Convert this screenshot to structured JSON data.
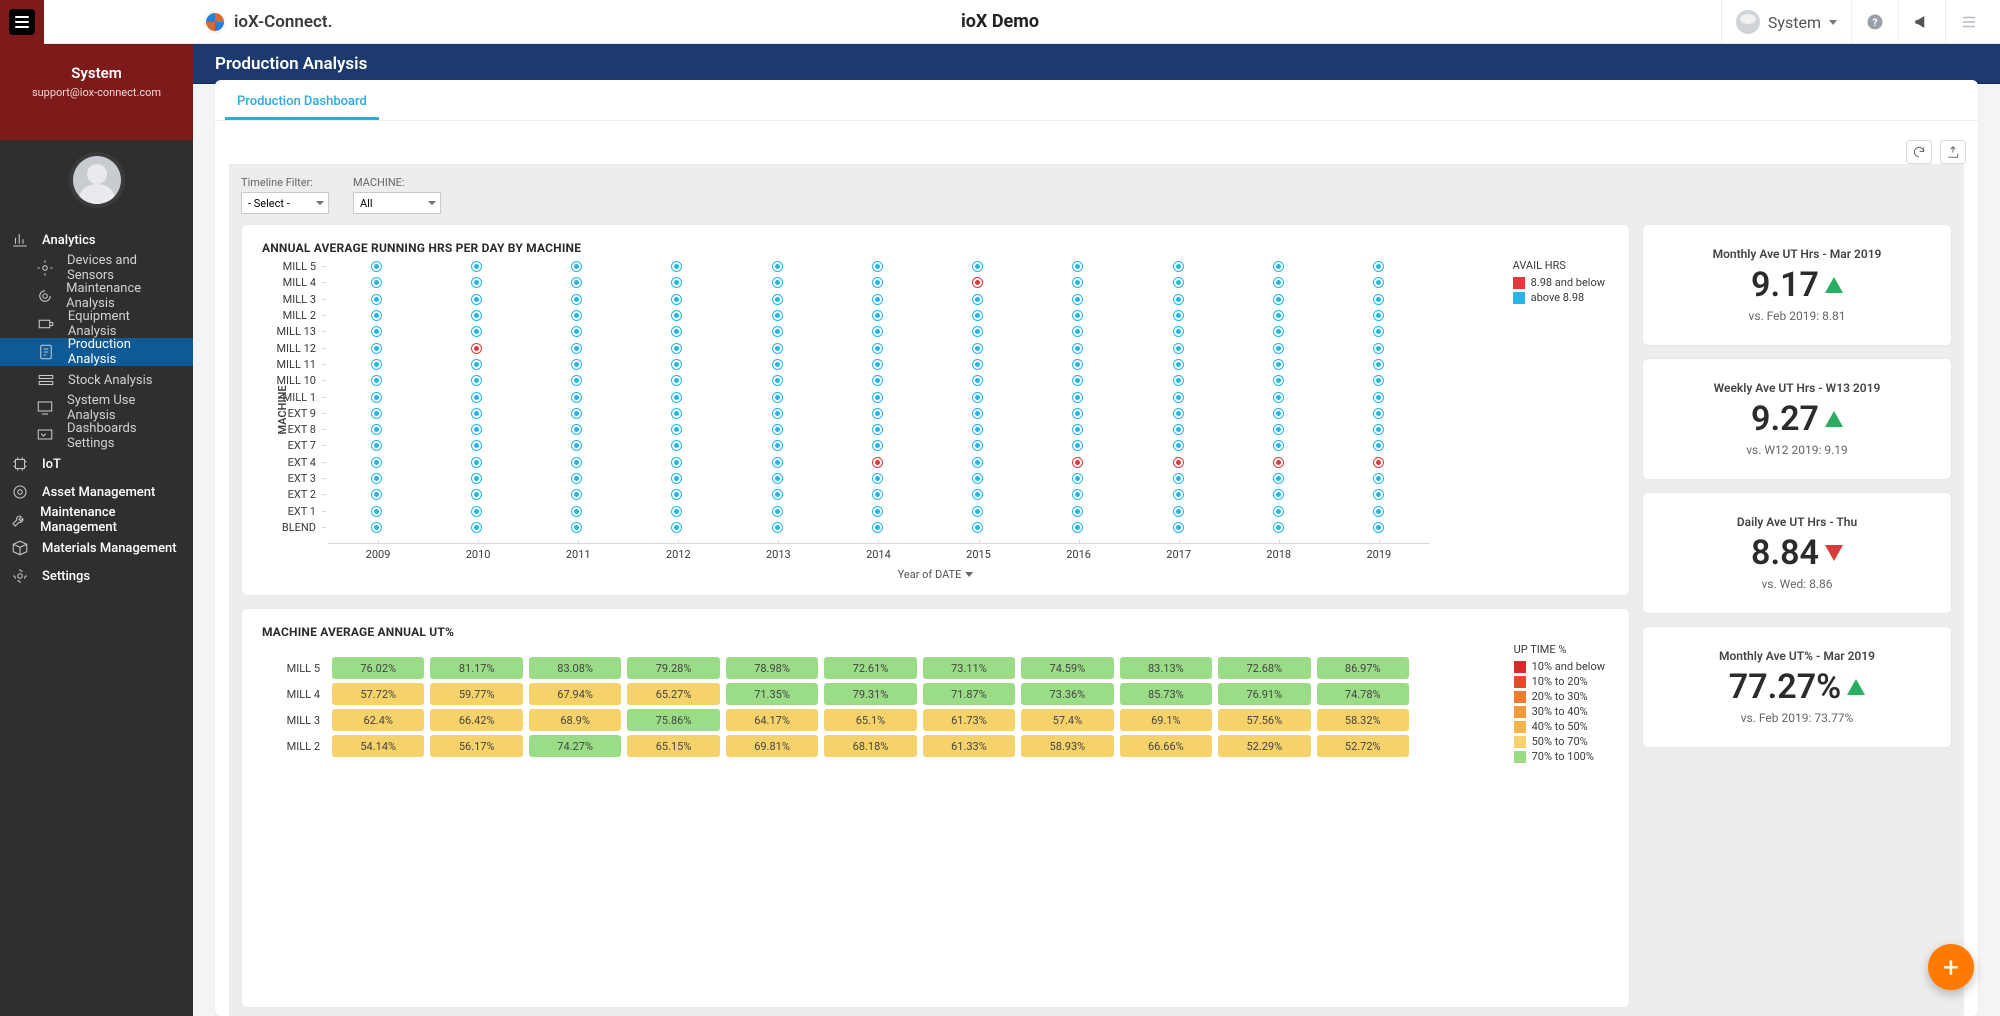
{
  "header": {
    "brand": "ioX-Connect.",
    "app_title": "ioX Demo",
    "user_label": "System"
  },
  "sidebar": {
    "user_name": "System",
    "user_email": "support@iox-connect.com",
    "top_items": [
      {
        "label": "Analytics",
        "top": true
      },
      {
        "label": "Devices and Sensors"
      },
      {
        "label": "Maintenance Analysis"
      },
      {
        "label": "Equipment Analysis"
      },
      {
        "label": "Production Analysis",
        "active": true
      },
      {
        "label": "Stock Analysis"
      },
      {
        "label": "System Use Analysis"
      },
      {
        "label": "Dashboards Settings"
      },
      {
        "label": "IoT",
        "top": true
      },
      {
        "label": "Asset Management",
        "top": true
      },
      {
        "label": "Maintenance Management",
        "top": true
      },
      {
        "label": "Materials Management",
        "top": true
      },
      {
        "label": "Settings",
        "top": true
      }
    ]
  },
  "page": {
    "title": "Production Analysis",
    "tab": "Production Dashboard",
    "filters": {
      "timeline_label": "Timeline Filter:",
      "timeline_value": "- Select -",
      "machine_label": "MACHINE:",
      "machine_value": "All"
    }
  },
  "chart_data": [
    {
      "type": "scatter",
      "title": "ANNUAL AVERAGE RUNNING HRS PER DAY BY MACHINE",
      "ylabel": "MACHINE",
      "xlabel": "Year of DATE",
      "x": [
        "2009",
        "2010",
        "2011",
        "2012",
        "2013",
        "2014",
        "2015",
        "2016",
        "2017",
        "2018",
        "2019"
      ],
      "legend_title": "AVAIL HRS",
      "legend": [
        {
          "label": "8.98 and below",
          "color": "#e03a3a"
        },
        {
          "label": "above 8.98",
          "color": "#25b6e8"
        }
      ],
      "rows": [
        {
          "label": "MILL 5",
          "v": [
            "c",
            "c",
            "c",
            "c",
            "c",
            "c",
            "c",
            "c",
            "c",
            "c",
            "c"
          ]
        },
        {
          "label": "MILL 4",
          "v": [
            "c",
            "c",
            "c",
            "c",
            "c",
            "c",
            "r",
            "c",
            "c",
            "c",
            "c"
          ]
        },
        {
          "label": "MILL 3",
          "v": [
            "c",
            "c",
            "c",
            "c",
            "c",
            "c",
            "c",
            "c",
            "c",
            "c",
            "c"
          ]
        },
        {
          "label": "MILL 2",
          "v": [
            "c",
            "c",
            "c",
            "c",
            "c",
            "c",
            "c",
            "c",
            "c",
            "c",
            "c"
          ]
        },
        {
          "label": "MILL 13",
          "v": [
            "c",
            "c",
            "c",
            "c",
            "c",
            "c",
            "c",
            "c",
            "c",
            "c",
            "c"
          ]
        },
        {
          "label": "MILL 12",
          "v": [
            "c",
            "r",
            "c",
            "c",
            "c",
            "c",
            "c",
            "c",
            "c",
            "c",
            "c"
          ]
        },
        {
          "label": "MILL 11",
          "v": [
            "c",
            "c",
            "c",
            "c",
            "c",
            "c",
            "c",
            "c",
            "c",
            "c",
            "c"
          ]
        },
        {
          "label": "MILL 10",
          "v": [
            "c",
            "c",
            "c",
            "c",
            "c",
            "c",
            "c",
            "c",
            "c",
            "c",
            "c"
          ]
        },
        {
          "label": "MILL 1",
          "v": [
            "c",
            "c",
            "c",
            "c",
            "c",
            "c",
            "c",
            "c",
            "c",
            "c",
            "c"
          ]
        },
        {
          "label": "EXT 9",
          "v": [
            "c",
            "c",
            "c",
            "c",
            "c",
            "c",
            "c",
            "c",
            "c",
            "c",
            "c"
          ]
        },
        {
          "label": "EXT 8",
          "v": [
            "c",
            "c",
            "c",
            "c",
            "c",
            "c",
            "c",
            "c",
            "c",
            "c",
            "c"
          ]
        },
        {
          "label": "EXT 7",
          "v": [
            "c",
            "c",
            "c",
            "c",
            "c",
            "c",
            "c",
            "c",
            "c",
            "c",
            "c"
          ]
        },
        {
          "label": "EXT 4",
          "v": [
            "c",
            "c",
            "c",
            "c",
            "c",
            "r",
            "c",
            "r",
            "r",
            "r",
            "r",
            "r"
          ]
        },
        {
          "label": "EXT 3",
          "v": [
            "c",
            "c",
            "c",
            "c",
            "c",
            "c",
            "c",
            "c",
            "c",
            "c",
            "c"
          ]
        },
        {
          "label": "EXT 2",
          "v": [
            "c",
            "c",
            "c",
            "c",
            "c",
            "c",
            "c",
            "c",
            "c",
            "c",
            "c"
          ]
        },
        {
          "label": "EXT 1",
          "v": [
            "c",
            "c",
            "c",
            "c",
            "c",
            "c",
            "c",
            "c",
            "c",
            "c",
            "c"
          ]
        },
        {
          "label": "BLEND",
          "v": [
            "c",
            "c",
            "c",
            "c",
            "c",
            "c",
            "c",
            "c",
            "c",
            "c",
            "c"
          ]
        }
      ]
    },
    {
      "type": "heatmap",
      "title": "MACHINE AVERAGE ANNUAL UT%",
      "legend_title": "UP TIME %",
      "legend": [
        {
          "label": "10% and below",
          "color": "#d62a2a"
        },
        {
          "label": "10% to 20%",
          "color": "#e34a2a"
        },
        {
          "label": "20% to 30%",
          "color": "#ef7b2f"
        },
        {
          "label": "30% to 40%",
          "color": "#f29a3a"
        },
        {
          "label": "40% to 50%",
          "color": "#f4b64a"
        },
        {
          "label": "50% to 70%",
          "color": "#f6d26a"
        },
        {
          "label": "70% to 100%",
          "color": "#9bdc86"
        }
      ],
      "rows": [
        {
          "label": "MILL 5",
          "cells": [
            {
              "v": "76.02%",
              "c": "#9bdc86"
            },
            {
              "v": "81.17%",
              "c": "#9bdc86"
            },
            {
              "v": "83.08%",
              "c": "#9bdc86"
            },
            {
              "v": "79.28%",
              "c": "#9bdc86"
            },
            {
              "v": "78.98%",
              "c": "#9bdc86"
            },
            {
              "v": "72.61%",
              "c": "#9bdc86"
            },
            {
              "v": "73.11%",
              "c": "#9bdc86"
            },
            {
              "v": "74.59%",
              "c": "#9bdc86"
            },
            {
              "v": "83.13%",
              "c": "#9bdc86"
            },
            {
              "v": "72.68%",
              "c": "#9bdc86"
            },
            {
              "v": "86.97%",
              "c": "#9bdc86"
            }
          ]
        },
        {
          "label": "MILL 4",
          "cells": [
            {
              "v": "57.72%",
              "c": "#f6d26a"
            },
            {
              "v": "59.77%",
              "c": "#f6d26a"
            },
            {
              "v": "67.94%",
              "c": "#f6d26a"
            },
            {
              "v": "65.27%",
              "c": "#f6d26a"
            },
            {
              "v": "71.35%",
              "c": "#9bdc86"
            },
            {
              "v": "79.31%",
              "c": "#9bdc86"
            },
            {
              "v": "71.87%",
              "c": "#9bdc86"
            },
            {
              "v": "73.36%",
              "c": "#9bdc86"
            },
            {
              "v": "85.73%",
              "c": "#9bdc86"
            },
            {
              "v": "76.91%",
              "c": "#9bdc86"
            },
            {
              "v": "74.78%",
              "c": "#9bdc86"
            }
          ]
        },
        {
          "label": "MILL 3",
          "cells": [
            {
              "v": "62.4%",
              "c": "#f6d26a"
            },
            {
              "v": "66.42%",
              "c": "#f6d26a"
            },
            {
              "v": "68.9%",
              "c": "#f6d26a"
            },
            {
              "v": "75.86%",
              "c": "#9bdc86"
            },
            {
              "v": "64.17%",
              "c": "#f6d26a"
            },
            {
              "v": "65.1%",
              "c": "#f6d26a"
            },
            {
              "v": "61.73%",
              "c": "#f6d26a"
            },
            {
              "v": "57.4%",
              "c": "#f6d26a"
            },
            {
              "v": "69.1%",
              "c": "#f6d26a"
            },
            {
              "v": "57.56%",
              "c": "#f6d26a"
            },
            {
              "v": "58.32%",
              "c": "#f6d26a"
            }
          ]
        },
        {
          "label": "MILL 2",
          "cells": [
            {
              "v": "54.14%",
              "c": "#f6d26a"
            },
            {
              "v": "56.17%",
              "c": "#f6d26a"
            },
            {
              "v": "74.27%",
              "c": "#9bdc86"
            },
            {
              "v": "65.15%",
              "c": "#f6d26a"
            },
            {
              "v": "69.81%",
              "c": "#f6d26a"
            },
            {
              "v": "68.18%",
              "c": "#f6d26a"
            },
            {
              "v": "61.33%",
              "c": "#f6d26a"
            },
            {
              "v": "58.93%",
              "c": "#f6d26a"
            },
            {
              "v": "66.66%",
              "c": "#f6d26a"
            },
            {
              "v": "52.29%",
              "c": "#f6d26a"
            },
            {
              "v": "52.72%",
              "c": "#f6d26a"
            }
          ]
        }
      ]
    }
  ],
  "kpis": [
    {
      "title": "Monthly Ave UT Hrs - Mar 2019",
      "value": "9.17",
      "dir": "up",
      "compare": "vs. Feb 2019: 8.81"
    },
    {
      "title": "Weekly Ave UT Hrs - W13 2019",
      "value": "9.27",
      "dir": "up",
      "compare": "vs. W12 2019: 9.19"
    },
    {
      "title": "Daily Ave UT Hrs - Thu",
      "value": "8.84",
      "dir": "down",
      "compare": "vs. Wed: 8.86"
    },
    {
      "title": "Monthly Ave UT% - Mar 2019",
      "value": "77.27%",
      "dir": "up",
      "compare": "vs. Feb 2019: 73.77%"
    }
  ]
}
